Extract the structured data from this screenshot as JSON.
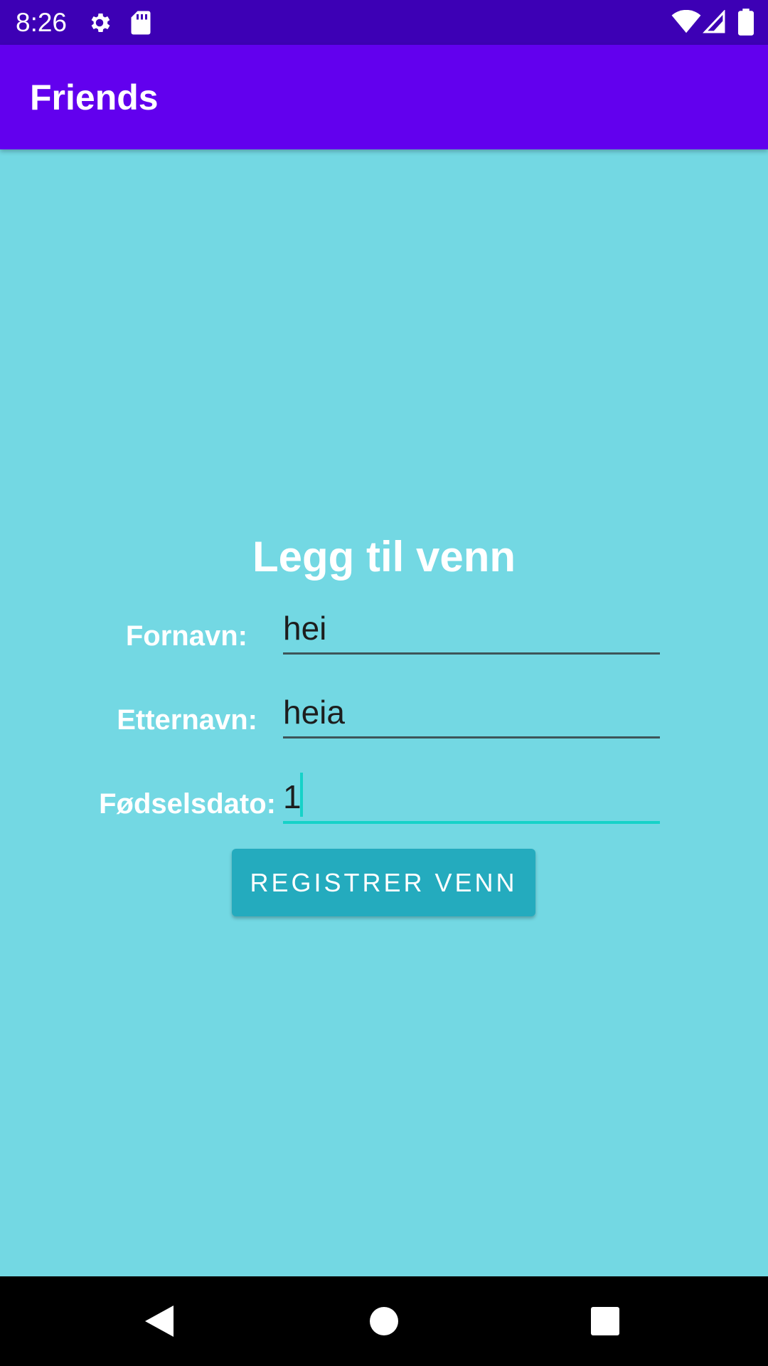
{
  "status_bar": {
    "time": "8:26",
    "icons": [
      "gear-icon",
      "sd-card-icon",
      "wifi-icon",
      "signal-icon",
      "battery-icon"
    ]
  },
  "app_bar": {
    "title": "Friends"
  },
  "form": {
    "title": "Legg til venn",
    "fields": [
      {
        "label": "Fornavn:",
        "value": "hei"
      },
      {
        "label": "Etternavn:",
        "value": "heia"
      },
      {
        "label": "Fødselsdato:",
        "value": "1"
      }
    ],
    "submit_label": "REGISTRER VENN"
  },
  "nav_bar": {
    "icons": [
      "back-icon",
      "home-icon",
      "recents-icon"
    ]
  },
  "colors": {
    "status_bar": "#3d00b5",
    "app_bar": "#6200ee",
    "background": "#73d8e3",
    "button": "#24abbe",
    "accent": "#16d2c8"
  }
}
